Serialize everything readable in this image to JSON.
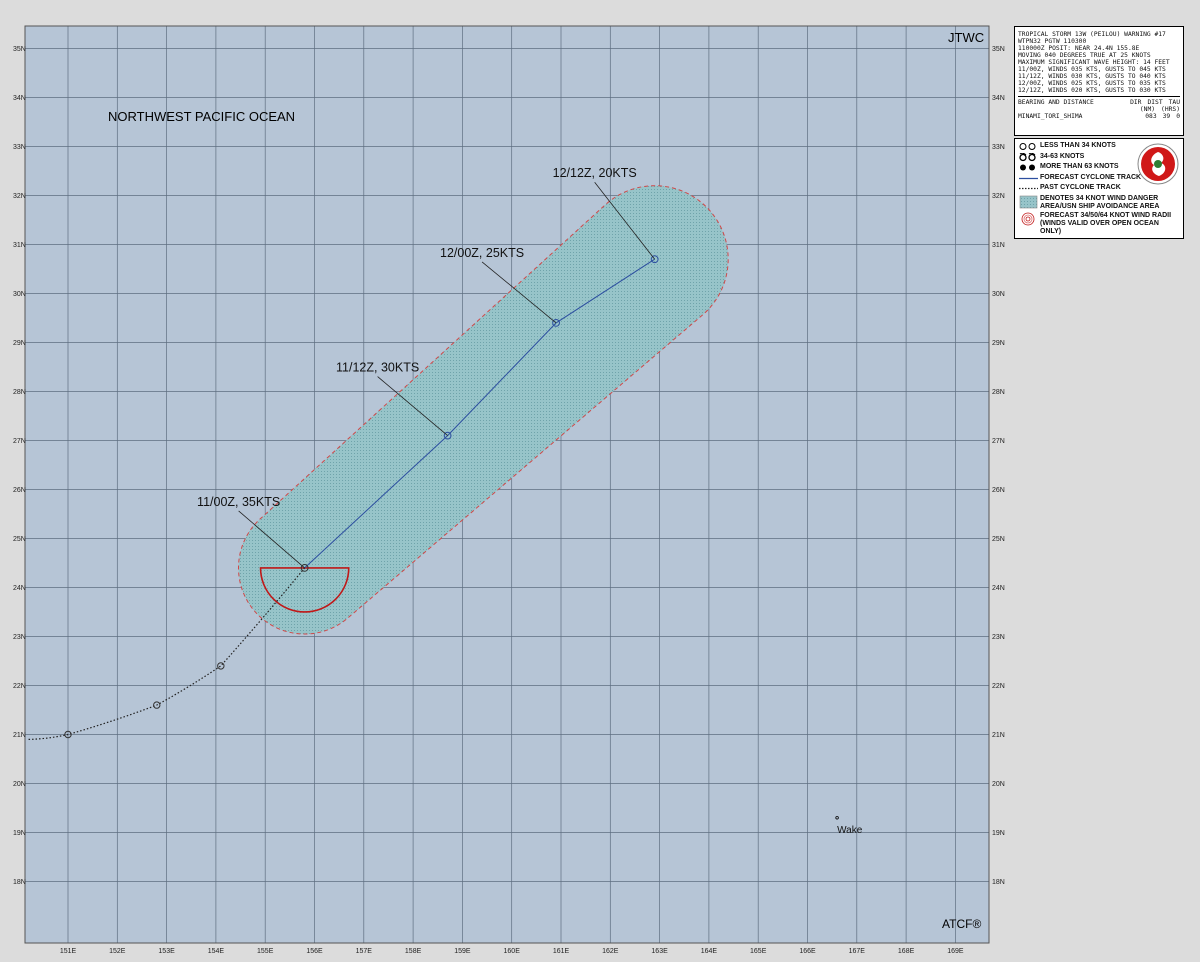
{
  "agency_label": "JTWC",
  "software_label": "ATCF®",
  "region_label": "NORTHWEST PACIFIC OCEAN",
  "island_label": "Wake",
  "map": {
    "lon_range": [
      150,
      164
    ],
    "lat_range": [
      17,
      35
    ],
    "lon_ticks": [
      "151E",
      "152E",
      "153E",
      "154E",
      "155E",
      "156E",
      "157E",
      "158E",
      "159E",
      "160E",
      "161E",
      "162E",
      "163E",
      "164E",
      "165E",
      "166E",
      "167E",
      "168E",
      "169E"
    ],
    "lat_ticks": [
      "35N",
      "34N",
      "33N",
      "32N",
      "31N",
      "30N",
      "29N",
      "28N",
      "27N",
      "26N",
      "25N",
      "24N",
      "23N",
      "22N",
      "21N",
      "20N",
      "19N",
      "18N"
    ],
    "colors": {
      "ocean": "#b6c5d6",
      "grid": "#5e6e80",
      "danger_area": "#97c4c9",
      "danger_border": "#d04848",
      "forecast_track": "#2d4fa0",
      "past_track": "#222222",
      "wind_radii": "#c01818"
    }
  },
  "forecast_points": [
    {
      "label": "11/00Z, 35KTS",
      "lon": 155.8,
      "lat": 24.4
    },
    {
      "label": "11/12Z, 30KTS",
      "lon": 158.7,
      "lat": 27.1
    },
    {
      "label": "12/00Z, 25KTS",
      "lon": 160.9,
      "lat": 29.4
    },
    {
      "label": "12/12Z, 20KTS",
      "lon": 162.9,
      "lat": 30.7
    }
  ],
  "past_track": [
    {
      "lon": 150.2,
      "lat": 20.9
    },
    {
      "lon": 151.0,
      "lat": 21.0
    },
    {
      "lon": 152.8,
      "lat": 21.6
    },
    {
      "lon": 154.1,
      "lat": 22.4
    },
    {
      "lon": 155.8,
      "lat": 24.4
    }
  ],
  "wake_island": {
    "lon": 166.6,
    "lat": 19.3
  },
  "info": {
    "title": "TROPICAL STORM 13W (PEILOU) WARNING #17",
    "lines": [
      "WTPN32 PGTW 110300",
      "110000Z POSIT: NEAR 24.4N 155.8E",
      "MOVING 040 DEGREES TRUE AT 25 KNOTS",
      "MAXIMUM SIGNIFICANT WAVE HEIGHT: 14 FEET",
      "11/00Z, WINDS 035 KTS, GUSTS TO 045 KTS",
      "11/12Z, WINDS 030 KTS, GUSTS TO 040 KTS",
      "12/00Z, WINDS 025 KTS, GUSTS TO 035 KTS",
      "12/12Z, WINDS 020 KTS, GUSTS TO 030 KTS"
    ],
    "bearing_header": "BEARING AND DISTANCE",
    "col_dir": "DIR",
    "col_dist": "DIST",
    "col_tau": "TAU",
    "col_dist_unit": "(NM)",
    "col_tau_unit": "(HRS)",
    "station": "MINAMI_TORI_SHIMA",
    "dir": "083",
    "dist": "39",
    "tau": "0"
  },
  "legend": {
    "items": [
      {
        "symbol": "lt34",
        "text": "LESS THAN 34 KNOTS"
      },
      {
        "symbol": "34to63",
        "text": "34-63 KNOTS"
      },
      {
        "symbol": "gt63",
        "text": "MORE THAN 63 KNOTS"
      },
      {
        "symbol": "forecast-track",
        "text": "FORECAST CYCLONE TRACK"
      },
      {
        "symbol": "past-track",
        "text": "PAST CYCLONE TRACK"
      },
      {
        "symbol": "danger",
        "text": "DENOTES 34 KNOT WIND DANGER AREA/USN SHIP AVOIDANCE AREA"
      },
      {
        "symbol": "radii",
        "text": "FORECAST 34/50/64 KNOT WIND RADII (WINDS VALID OVER OPEN OCEAN ONLY)"
      }
    ]
  }
}
